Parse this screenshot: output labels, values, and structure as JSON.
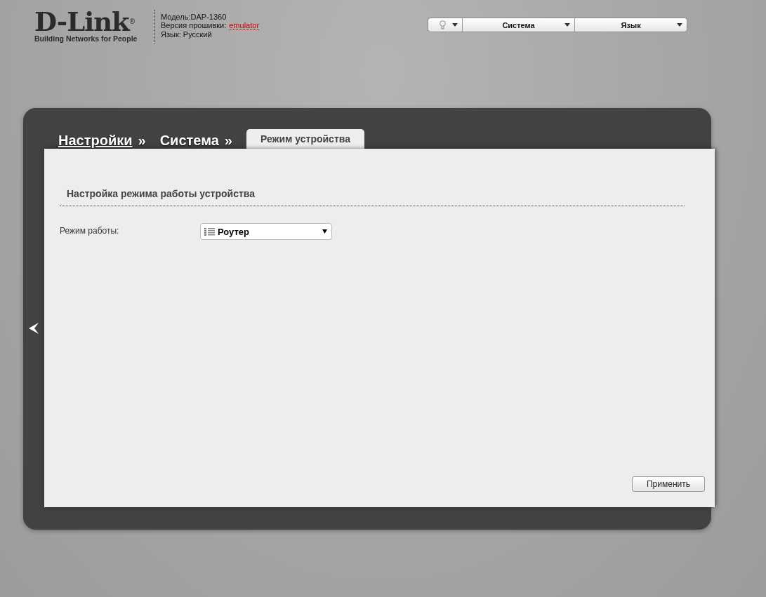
{
  "logo": {
    "brand": "D-Link",
    "mark": "®",
    "tagline": "Building Networks for People"
  },
  "device_info": {
    "model_label": "Модель:",
    "model": "DAP-1360",
    "firmware_label": "Версия прошивки:",
    "firmware": "emulator",
    "language_label": "Язык:",
    "language": "Русский"
  },
  "top_menu": [
    {
      "kind": "icon"
    },
    {
      "kind": "text",
      "label": "Система"
    },
    {
      "kind": "text",
      "label": "Язык"
    }
  ],
  "breadcrumbs": [
    {
      "label": "Настройки",
      "separator": "»",
      "link": true
    },
    {
      "label": "Система",
      "separator": "»",
      "link": false
    }
  ],
  "active_tab": {
    "label": "Режим устройства",
    "selected": true
  },
  "section_title": "Настройка режима работы устройства",
  "fields": [
    {
      "label": "Режим работы:",
      "value": "Роутер"
    }
  ],
  "apply_button": "Применить"
}
